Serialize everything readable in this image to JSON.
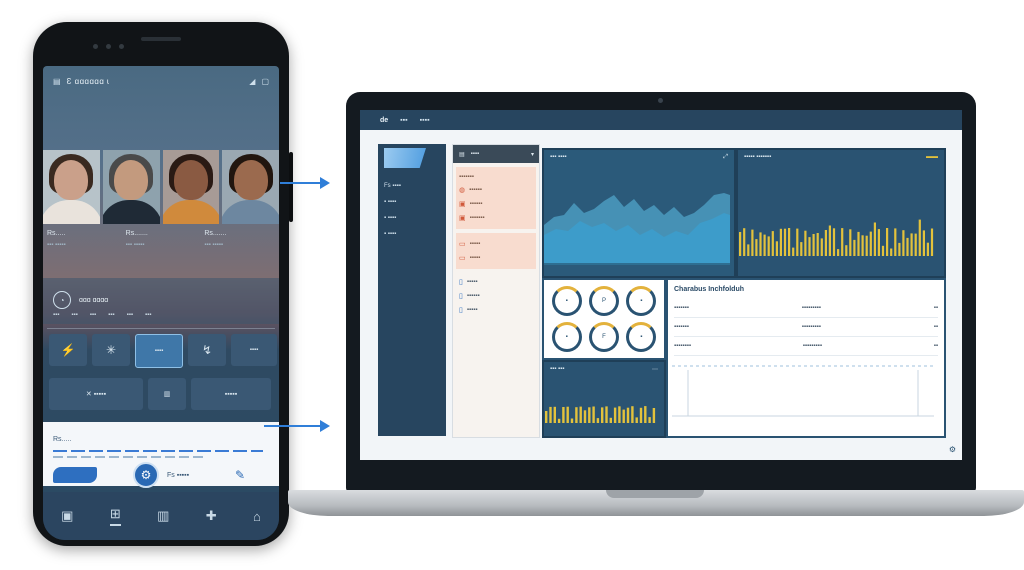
{
  "phone": {
    "app_title": "Ɛ ɑɑɑɑɑɑ ɩ",
    "people": [
      {
        "name": "Rs.....",
        "sub": "▪▪▪ ▪▪▪▪▪"
      },
      {
        "name": "Rs.......",
        "sub": "▪▪▪ ▪▪▪▪▪"
      },
      {
        "name": "Rs.......",
        "sub": "▪▪▪ ▪▪▪▪▪"
      }
    ],
    "band_label": "ɑɑɑ ɑɑɑɑ",
    "band_values": [
      "▪▪▪",
      "▪▪▪",
      "▪▪▪",
      "▪▪▪",
      "▪▪▪",
      "▪▪▪"
    ],
    "tiles_row1": [
      "⚡",
      "✳",
      "▪▪▪▪",
      "↯",
      "▪▪▪▪"
    ],
    "tiles_row2": [
      "✕ ▪▪▪▪▪",
      "▥",
      "▪▪▪▪▪"
    ],
    "card_title": "Rs.....",
    "card_text": "Fs ▪▪▪▪▪",
    "nav_icons": [
      "▣",
      "⊞",
      "▥",
      "✚",
      "⌂"
    ]
  },
  "laptop": {
    "brand": "de",
    "top_items": [
      "▪▪▪",
      "▪▪▪▪"
    ],
    "sidebar": [
      "Fs ▪▪▪▪",
      "▪ ▪▪▪▪",
      "▪ ▪▪▪▪",
      "▪ ▪▪▪▪"
    ],
    "panel_head": "▪▪▪▪",
    "panel_items_a": [
      "▪▪▪▪▪▪▪",
      "▪▪▪▪▪▪",
      "▪▪▪▪▪▪",
      "▪▪▪▪▪▪▪"
    ],
    "panel_items_b": [
      "▪▪▪▪▪",
      "▪▪▪▪▪"
    ],
    "panel_items_c": [
      "▪▪▪▪▪",
      "▪▪▪▪▪▪",
      "▪▪▪▪▪"
    ],
    "area_title": "▪▪▪ ▪▪▪▪",
    "bar_title": "▪▪▪▪▪ ▪▪▪▪▪▪▪",
    "gauges": [
      "▪",
      "P",
      "▪",
      "▪",
      "F",
      "▪"
    ],
    "table_title": "Charabus Inchfolduh",
    "table_rows": [
      [
        "▪▪▪▪▪▪▪",
        "▪▪▪▪▪▪▪▪▪",
        "▪▪"
      ],
      [
        "▪▪▪▪▪▪▪",
        "▪▪▪▪▪▪▪▪▪",
        "▪▪"
      ],
      [
        "▪▪▪▪▪▪▪▪",
        "▪▪▪▪▪▪▪▪▪",
        "▪▪"
      ]
    ],
    "mini_title": "▪▪▪ ▪▪▪"
  },
  "colors": {
    "accent": "#2f7ed8",
    "panel": "#2a5372",
    "chart_fill": "#4aa9d6",
    "bar_gold": "#e3c23c"
  }
}
